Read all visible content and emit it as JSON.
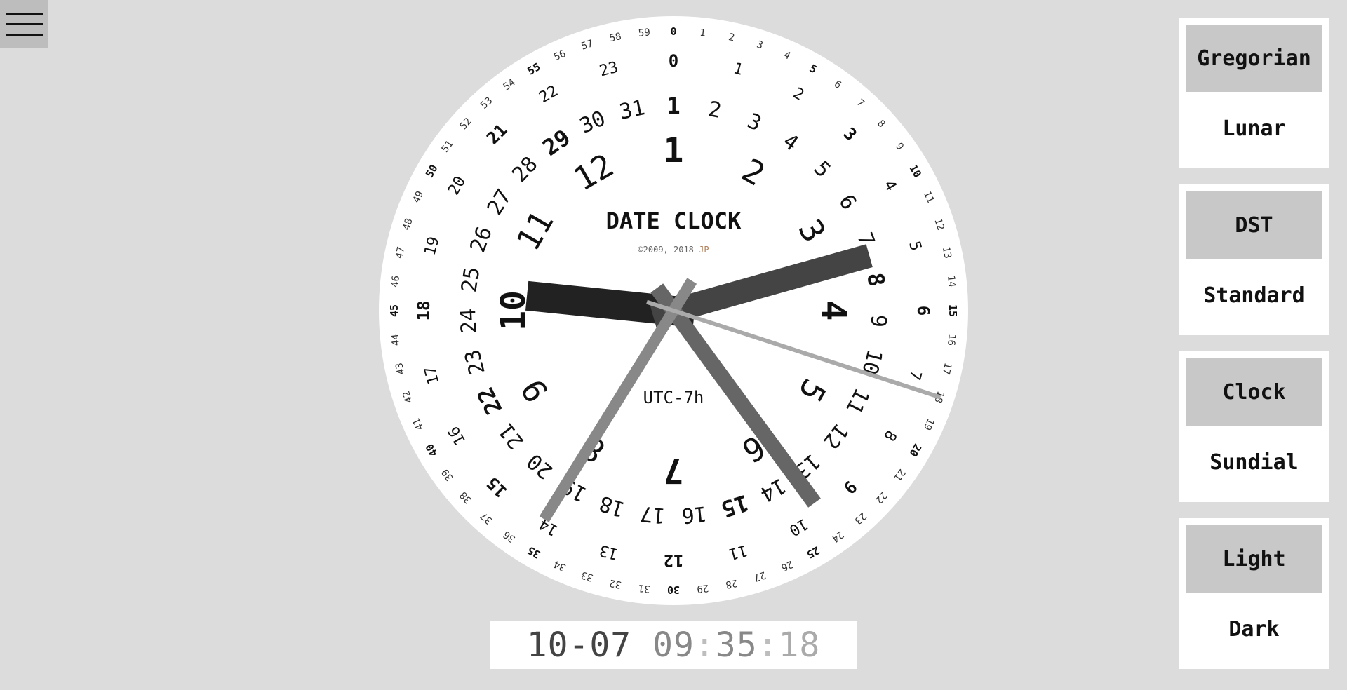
{
  "menu": {
    "icon": "hamburger-menu-icon"
  },
  "clock": {
    "title": "DATE CLOCK",
    "copyright_prefix": "©2009, 2018 ",
    "copyright_author": "JP",
    "timezone": "UTC-7h",
    "time": {
      "month": 10,
      "day": 7,
      "hour": 9,
      "minute": 35,
      "second": 18
    },
    "days_in_month": 31,
    "month_labels": [
      "1",
      "2",
      "3",
      "4",
      "5",
      "6",
      "7",
      "8",
      "9",
      "10",
      "11",
      "12"
    ],
    "highlighted_month": "10",
    "hands": [
      "month-hand",
      "day-hand",
      "hour-hand",
      "minute-hand",
      "second-hand"
    ],
    "colors": {
      "face": "#ffffff",
      "month_hand": "#222222",
      "day_hand": "#444444",
      "hour_hand": "#666666",
      "minute_hand": "#888888",
      "second_hand": "#aaaaaa",
      "copyright_author": "#b0805a"
    }
  },
  "readout": {
    "date": "10-07",
    "hour": "09",
    "sep1": ":",
    "minute": "35",
    "sep2": ":",
    "second": "18"
  },
  "panels": [
    {
      "selected": "Gregorian",
      "alternative": "Lunar"
    },
    {
      "selected": "DST",
      "alternative": "Standard"
    },
    {
      "selected": "Clock",
      "alternative": "Sundial"
    },
    {
      "selected": "Light",
      "alternative": "Dark"
    }
  ]
}
